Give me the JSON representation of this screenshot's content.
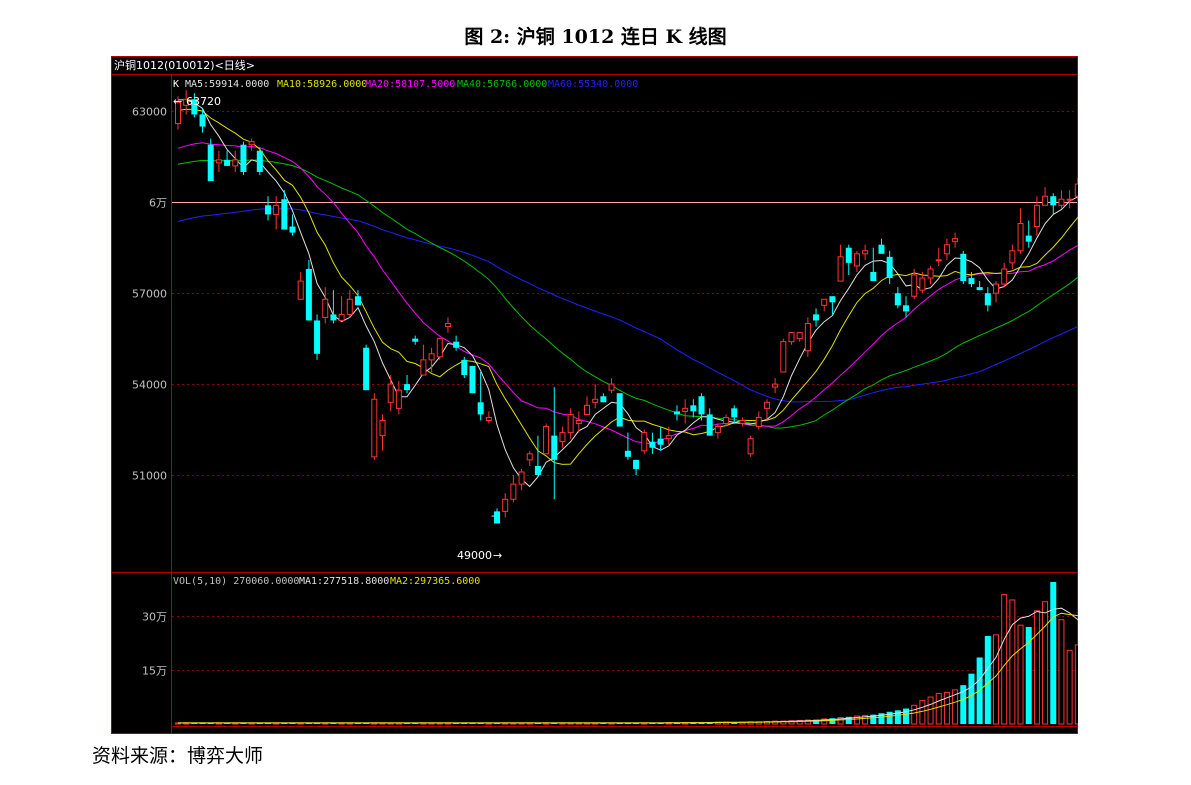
{
  "figure_title": "图 2:  沪铜 1012 连日 K 线图",
  "source_text": "资料来源：博弈大师",
  "panel_title": "沪铜1012(010012)<日线>",
  "indicators": {
    "k_label": "K",
    "ma5": "MA5:59914.0000",
    "ma10": "MA10:58926.0000",
    "ma20": "MA20:58107.5000",
    "ma40": "MA40:56766.0000",
    "ma60": "MA60:55340.0000",
    "vol": "VOL(5,10) 270060.0000",
    "vol_ma1": "MA1:277518.8000",
    "vol_ma2": "MA2:297365.6000"
  },
  "annotations": {
    "high": "63720",
    "low": "49000"
  },
  "colors": {
    "background": "#000000",
    "up": "#ff3333",
    "down": "#00ffff",
    "ma5": "#e0e0e0",
    "ma10": "#e0e000",
    "ma20": "#ff00ff",
    "ma40": "#00c000",
    "ma60": "#2020ff",
    "grid": "#8b0000",
    "frame": "#b00000",
    "axis_text": "#c0c0c0",
    "refline": "#ffaaaa"
  },
  "chart_data": [
    {
      "type": "candlestick",
      "title": "沪铜1012(010012)<日线>",
      "y_ticks": [
        "63000",
        "6万",
        "57000",
        "54000",
        "51000"
      ],
      "y_tick_values": [
        63000,
        60000,
        57000,
        54000,
        51000
      ],
      "ylim": [
        47800,
        64200
      ],
      "candles": [
        [
          62600,
          63500,
          62400,
          63300
        ],
        [
          63200,
          63700,
          62900,
          63400
        ],
        [
          63400,
          63600,
          62800,
          62900
        ],
        [
          62900,
          63100,
          62300,
          62500
        ],
        [
          61900,
          62100,
          60700,
          60700
        ],
        [
          61300,
          61700,
          61000,
          61400
        ],
        [
          61400,
          61700,
          61200,
          61200
        ],
        [
          61200,
          61700,
          61000,
          61400
        ],
        [
          61900,
          62000,
          60900,
          61000
        ],
        [
          61900,
          62100,
          61700,
          62000
        ],
        [
          61700,
          61800,
          60900,
          61000
        ],
        [
          59900,
          60200,
          59400,
          59600
        ],
        [
          59600,
          60200,
          59100,
          59900
        ],
        [
          60100,
          60400,
          59500,
          59100
        ],
        [
          59200,
          59600,
          58900,
          59000
        ],
        [
          56800,
          57700,
          56800,
          57400
        ],
        [
          57800,
          58100,
          56900,
          56100
        ],
        [
          56100,
          56300,
          54800,
          55000
        ],
        [
          56200,
          57200,
          56000,
          56800
        ],
        [
          56300,
          57100,
          56000,
          56100
        ],
        [
          56100,
          56900,
          56100,
          56300
        ],
        [
          56300,
          57100,
          56200,
          56800
        ],
        [
          56900,
          57100,
          56600,
          56600
        ],
        [
          55200,
          55300,
          53800,
          53800
        ],
        [
          51600,
          53700,
          51500,
          53500
        ],
        [
          52300,
          53000,
          51800,
          52800
        ],
        [
          53400,
          54300,
          53100,
          54000
        ],
        [
          53200,
          54100,
          53000,
          53800
        ],
        [
          54000,
          54300,
          53700,
          53800
        ],
        [
          55500,
          55600,
          55300,
          55400
        ],
        [
          54300,
          55300,
          54300,
          54800
        ],
        [
          54800,
          55200,
          54400,
          55000
        ],
        [
          54900,
          55500,
          54800,
          55500
        ],
        [
          55900,
          56200,
          55700,
          56000
        ],
        [
          55400,
          55600,
          55100,
          55200
        ],
        [
          54800,
          54900,
          54200,
          54300
        ],
        [
          54600,
          54600,
          53700,
          53700
        ],
        [
          53400,
          54400,
          52800,
          53000
        ],
        [
          52800,
          53100,
          52700,
          52900
        ],
        [
          49800,
          49900,
          49400,
          49400
        ],
        [
          49800,
          50400,
          49600,
          50200
        ],
        [
          50200,
          51000,
          50100,
          50700
        ],
        [
          50700,
          51200,
          50500,
          51100
        ],
        [
          51500,
          51800,
          51300,
          51700
        ],
        [
          51300,
          52300,
          51100,
          51000
        ],
        [
          51700,
          52700,
          51700,
          52600
        ],
        [
          52300,
          53900,
          50200,
          51500
        ],
        [
          52100,
          52600,
          51900,
          52400
        ],
        [
          52400,
          53200,
          52200,
          53000
        ],
        [
          52700,
          53100,
          52400,
          52800
        ],
        [
          53000,
          53600,
          53000,
          53300
        ],
        [
          53400,
          54000,
          53200,
          53500
        ],
        [
          53600,
          53700,
          53400,
          53400
        ],
        [
          53800,
          54200,
          53700,
          54000
        ],
        [
          53700,
          53700,
          52600,
          52600
        ],
        [
          51800,
          52400,
          51500,
          51600
        ],
        [
          51500,
          51500,
          51000,
          51200
        ],
        [
          51800,
          52500,
          51700,
          52400
        ],
        [
          52100,
          52400,
          51700,
          51900
        ],
        [
          52200,
          52600,
          51800,
          52000
        ],
        [
          52200,
          52600,
          52000,
          52300
        ],
        [
          53100,
          53300,
          52800,
          53000
        ],
        [
          53100,
          53500,
          52700,
          53200
        ],
        [
          53300,
          53500,
          52900,
          53100
        ],
        [
          53600,
          53700,
          52800,
          53000
        ],
        [
          53000,
          53200,
          52300,
          52300
        ],
        [
          52400,
          52700,
          52200,
          52600
        ],
        [
          52700,
          53000,
          52600,
          52900
        ],
        [
          53200,
          53300,
          52700,
          52900
        ],
        [
          52700,
          52900,
          52600,
          52800
        ],
        [
          51700,
          52300,
          51600,
          52200
        ],
        [
          52600,
          53100,
          52500,
          52900
        ],
        [
          53200,
          53500,
          52800,
          53400
        ],
        [
          53900,
          54200,
          53700,
          54000
        ],
        [
          54400,
          55500,
          54400,
          55400
        ],
        [
          55400,
          55700,
          55300,
          55700
        ],
        [
          55500,
          55700,
          55400,
          55700
        ],
        [
          55100,
          56200,
          54900,
          56000
        ],
        [
          56300,
          56500,
          55900,
          56100
        ],
        [
          56600,
          56800,
          56400,
          56800
        ],
        [
          56900,
          56900,
          56300,
          56700
        ],
        [
          57400,
          58600,
          57400,
          58200
        ],
        [
          58500,
          58600,
          57600,
          58000
        ],
        [
          57900,
          58400,
          57700,
          58300
        ],
        [
          58300,
          58600,
          58100,
          58400
        ],
        [
          57700,
          58500,
          57400,
          57400
        ],
        [
          58600,
          58800,
          58300,
          58300
        ],
        [
          58200,
          58400,
          57300,
          57500
        ],
        [
          57000,
          57200,
          56500,
          56600
        ],
        [
          56600,
          56900,
          56200,
          56400
        ],
        [
          56900,
          57800,
          56800,
          57600
        ],
        [
          57100,
          57700,
          57000,
          57500
        ],
        [
          57500,
          57900,
          57300,
          57800
        ],
        [
          58100,
          58500,
          57900,
          58100
        ],
        [
          58300,
          58800,
          58100,
          58600
        ],
        [
          58700,
          59000,
          58500,
          58800
        ],
        [
          58300,
          58400,
          57300,
          57400
        ],
        [
          57500,
          57700,
          57200,
          57300
        ],
        [
          57200,
          57400,
          57100,
          57100
        ],
        [
          57000,
          57200,
          56400,
          56600
        ],
        [
          57000,
          57400,
          56700,
          57300
        ],
        [
          57300,
          58000,
          57200,
          57800
        ],
        [
          58000,
          58600,
          57800,
          58400
        ],
        [
          58400,
          59800,
          58300,
          59300
        ],
        [
          58900,
          59400,
          58500,
          58700
        ],
        [
          59200,
          60200,
          58900,
          59900
        ],
        [
          59900,
          60500,
          59900,
          60200
        ],
        [
          60200,
          60300,
          59600,
          59900
        ],
        [
          59900,
          60400,
          59800,
          60100
        ],
        [
          60100,
          60400,
          59800,
          60100
        ],
        [
          60200,
          60800,
          60100,
          60600
        ],
        [
          60300,
          60500,
          59500,
          59700
        ]
      ]
    },
    {
      "type": "bar",
      "title": "VOL(5,10)",
      "y_ticks": [
        "30万",
        "15万"
      ],
      "y_tick_values": [
        300000,
        150000
      ],
      "ylim": [
        0,
        420000
      ],
      "values": [
        3000,
        3000,
        3000,
        3000,
        3000,
        3000,
        3000,
        3000,
        3000,
        3000,
        3000,
        3000,
        3000,
        3000,
        3000,
        3000,
        3000,
        3000,
        3000,
        3000,
        3000,
        3000,
        3000,
        3000,
        3000,
        3000,
        3000,
        3000,
        3000,
        3000,
        3000,
        3000,
        3000,
        3000,
        3000,
        3000,
        3000,
        3000,
        3000,
        3000,
        3000,
        3000,
        3000,
        3000,
        3000,
        3000,
        3000,
        3000,
        3000,
        3000,
        3000,
        3000,
        3000,
        3000,
        3000,
        3000,
        3000,
        3000,
        3000,
        3000,
        4000,
        4000,
        4000,
        4000,
        4000,
        5000,
        5000,
        5000,
        5000,
        5000,
        6000,
        6000,
        7000,
        8000,
        8000,
        9000,
        10000,
        11000,
        12000,
        14000,
        16000,
        18000,
        20000,
        22000,
        24000,
        26000,
        30000,
        34000,
        38000,
        43000,
        52000,
        65000,
        75000,
        85000,
        88000,
        95000,
        108000,
        140000,
        185000,
        245000,
        248000,
        360000,
        345000,
        275000,
        270000,
        315000,
        340000,
        395000,
        290000,
        205000,
        220000,
        270000
      ]
    }
  ]
}
